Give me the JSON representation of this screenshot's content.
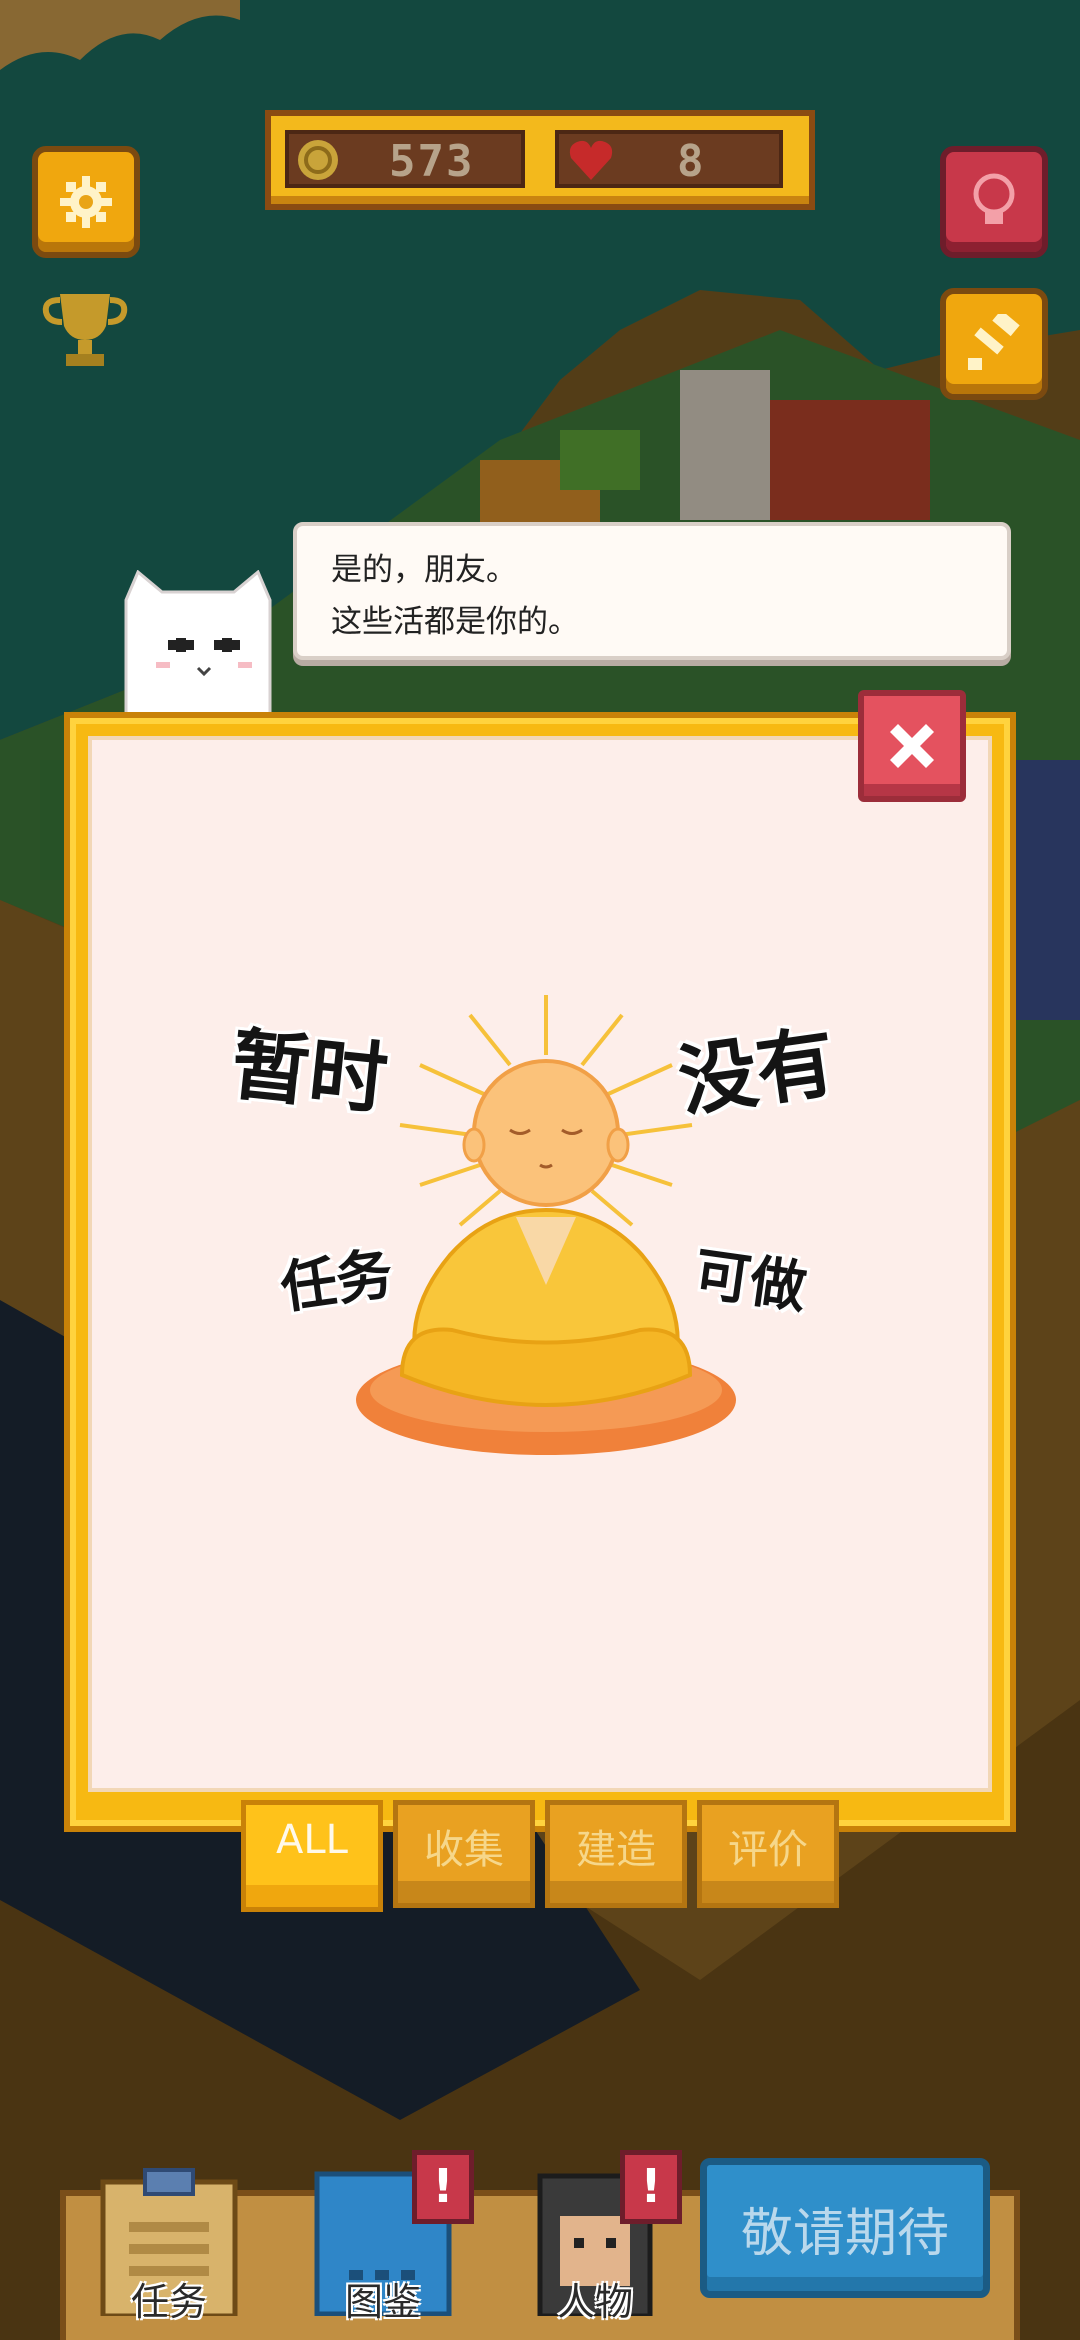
{
  "hud": {
    "coins": "573",
    "hearts": "8"
  },
  "speech": {
    "line1": "是的，朋友。",
    "line2": "这些活都是你的。"
  },
  "empty_state": {
    "word_top_left": "暂时",
    "word_top_right": "没有",
    "word_mid_left": "任务",
    "word_mid_right": "可做"
  },
  "tabs": [
    {
      "label": "ALL",
      "active": true
    },
    {
      "label": "收集",
      "active": false
    },
    {
      "label": "建造",
      "active": false
    },
    {
      "label": "评价",
      "active": false
    }
  ],
  "bottom_nav": {
    "tasks_label": "任务",
    "collection_label": "图鉴",
    "characters_label": "人物",
    "coming_soon_label": "敬请期待",
    "alert_mark": "!"
  },
  "icons": {
    "settings": "gear-icon",
    "trophy": "trophy-icon",
    "hint": "lightbulb-icon",
    "decorate": "paint-brush-icon",
    "close": "close-icon",
    "coin": "coin-icon",
    "heart": "heart-icon"
  },
  "colors": {
    "panel_gold": "#f7b912",
    "panel_bg": "#fdeeea",
    "close_red": "#e4525f",
    "sea": "#1d6b5e",
    "sand": "#c99a4c",
    "coming_blue": "#2f8fca"
  }
}
